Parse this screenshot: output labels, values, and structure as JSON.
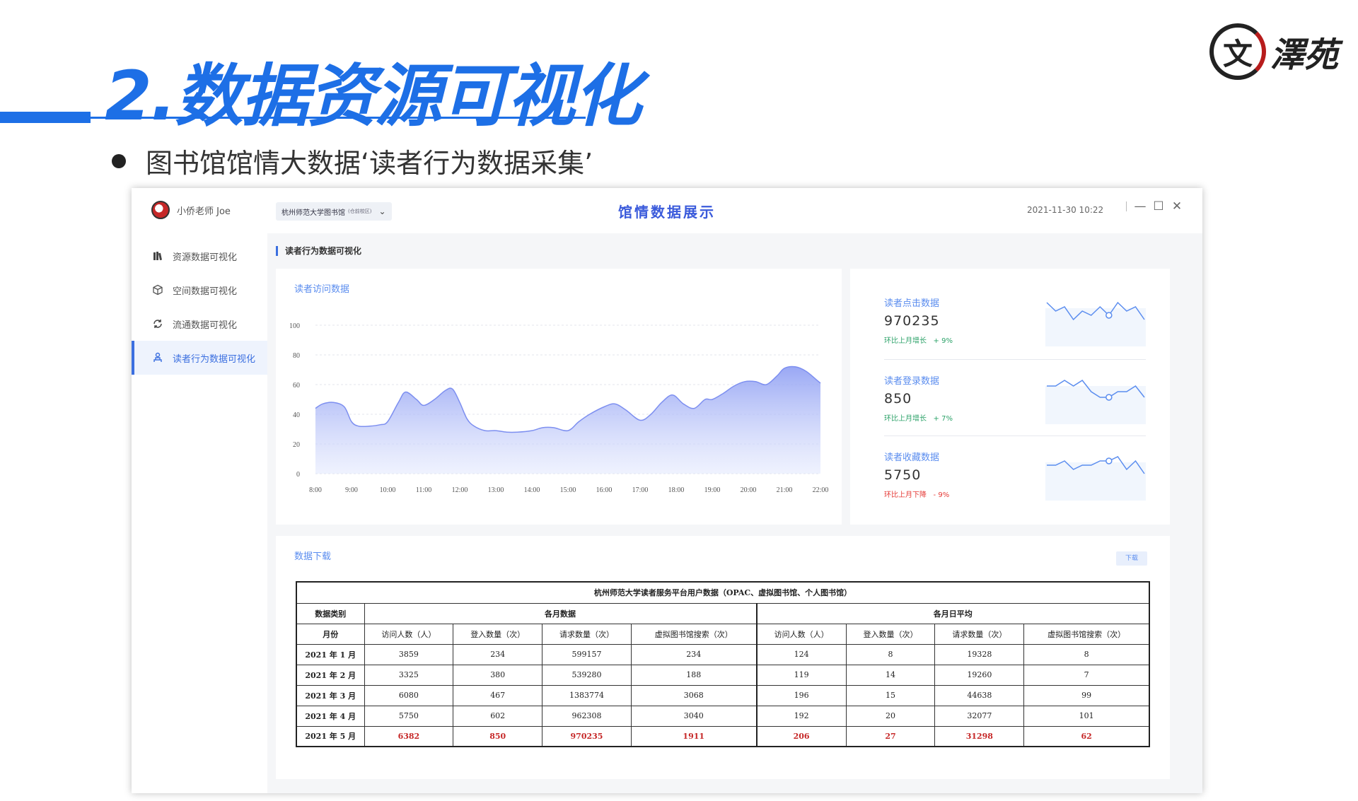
{
  "slide": {
    "title": "2.数据资源可视化",
    "bullet": "图书馆馆情大数据‘读者行为数据采集’",
    "logo_char": "文",
    "logo_rest": "澤苑"
  },
  "app": {
    "user_name": "小侨老师 Joe",
    "library_select": "杭州师范大学图书馆",
    "library_tag": "(仓前校区)",
    "window_title": "馆情数据展示",
    "datetime": "2021-11-30  10:22",
    "sidebar": [
      {
        "label": "资源数据可视化",
        "icon": "books-icon",
        "active": false
      },
      {
        "label": "空间数据可视化",
        "icon": "cube-icon",
        "active": false
      },
      {
        "label": "流通数据可视化",
        "icon": "cycle-icon",
        "active": false
      },
      {
        "label": "读者行为数据可视化",
        "icon": "reader-icon",
        "active": true
      }
    ],
    "breadcrumb": "读者行为数据可视化",
    "accent_color": "#3b6fe0"
  },
  "visits_panel": {
    "title": "读者访问数据"
  },
  "chart_data": {
    "type": "area",
    "title": "读者访问数据",
    "x": [
      "8:00",
      "9:00",
      "10:00",
      "11:00",
      "12:00",
      "13:00",
      "14:00",
      "15:00",
      "16:00",
      "17:00",
      "18:00",
      "19:00",
      "20:00",
      "21:00",
      "22:00"
    ],
    "series": [
      {
        "values_x": [
          8.0,
          8.2,
          8.5,
          8.8,
          9.0,
          9.2,
          9.5,
          9.8,
          10.0,
          10.3,
          10.5,
          10.8,
          11.0,
          11.3,
          11.6,
          11.8,
          12.0,
          12.2,
          12.4,
          12.7,
          13.0,
          13.3,
          13.6,
          14.0,
          14.3,
          14.6,
          15.0,
          15.3,
          15.6,
          16.0,
          16.3,
          16.6,
          17.0,
          17.3,
          17.6,
          17.9,
          18.2,
          18.5,
          18.8,
          19.0,
          19.3,
          19.6,
          19.9,
          20.2,
          20.5,
          20.8,
          21.0,
          21.3,
          21.6,
          21.9,
          22.0
        ],
        "values": [
          44,
          47,
          48,
          45,
          35,
          32,
          32,
          33,
          35,
          48,
          55,
          50,
          46,
          50,
          56,
          57,
          48,
          37,
          32,
          29,
          29,
          28,
          28,
          29,
          31,
          31,
          29,
          35,
          40,
          45,
          47,
          43,
          36,
          40,
          48,
          53,
          47,
          44,
          50,
          50,
          54,
          59,
          62,
          62,
          60,
          66,
          71,
          72,
          69,
          63,
          61
        ]
      }
    ],
    "ylim": [
      0,
      100
    ],
    "yticks": [
      0,
      20,
      40,
      60,
      80,
      100
    ],
    "grid": true
  },
  "stats": [
    {
      "label": "读者点击数据",
      "value": "970235",
      "change_label": "环比上月增长",
      "change": "+ 9%",
      "direction": "up",
      "spark": [
        6,
        4,
        5,
        2,
        4,
        3,
        5,
        3,
        6,
        4,
        5,
        2
      ]
    },
    {
      "label": "读者登录数据",
      "value": "850",
      "change_label": "环比上月增长",
      "change": "+ 7%",
      "direction": "up",
      "spark": [
        6,
        6,
        7,
        6,
        7,
        5,
        4,
        4,
        5,
        5,
        6,
        4
      ]
    },
    {
      "label": "读者收藏数据",
      "value": "5750",
      "change_label": "环比上月下降",
      "change": "- 9%",
      "direction": "down",
      "spark": [
        4,
        4,
        5,
        3,
        4,
        4,
        5,
        5,
        6,
        3,
        5,
        2
      ]
    }
  ],
  "download_panel": {
    "title": "数据下载",
    "button": "下载",
    "table": {
      "caption": "杭州师范大学读者服务平台用户数据（OPAC、虚拟图书馆、个人图书馆）",
      "category_label": "数据类别",
      "month_label": "月份",
      "group1": "各月数据",
      "group2": "各月日平均",
      "subheaders": [
        "访问人数（人）",
        "登入数量（次）",
        "请求数量（次）",
        "虚拟图书馆搜索（次）",
        "访问人数（人）",
        "登入数量（次）",
        "请求数量（次）",
        "虚拟图书馆搜索（次）"
      ],
      "rows": [
        {
          "month": "2021 年 1 月",
          "cells": [
            "3859",
            "234",
            "599157",
            "234",
            "124",
            "8",
            "19328",
            "8"
          ]
        },
        {
          "month": "2021 年 2 月",
          "cells": [
            "3325",
            "380",
            "539280",
            "188",
            "119",
            "14",
            "19260",
            "7"
          ]
        },
        {
          "month": "2021 年 3 月",
          "cells": [
            "6080",
            "467",
            "1383774",
            "3068",
            "196",
            "15",
            "44638",
            "99"
          ]
        },
        {
          "month": "2021 年 4 月",
          "cells": [
            "5750",
            "602",
            "962308",
            "3040",
            "192",
            "20",
            "32077",
            "101"
          ]
        },
        {
          "month": "2021 年 5 月",
          "cells": [
            "6382",
            "850",
            "970235",
            "1911",
            "206",
            "27",
            "31298",
            "62"
          ]
        }
      ]
    }
  }
}
